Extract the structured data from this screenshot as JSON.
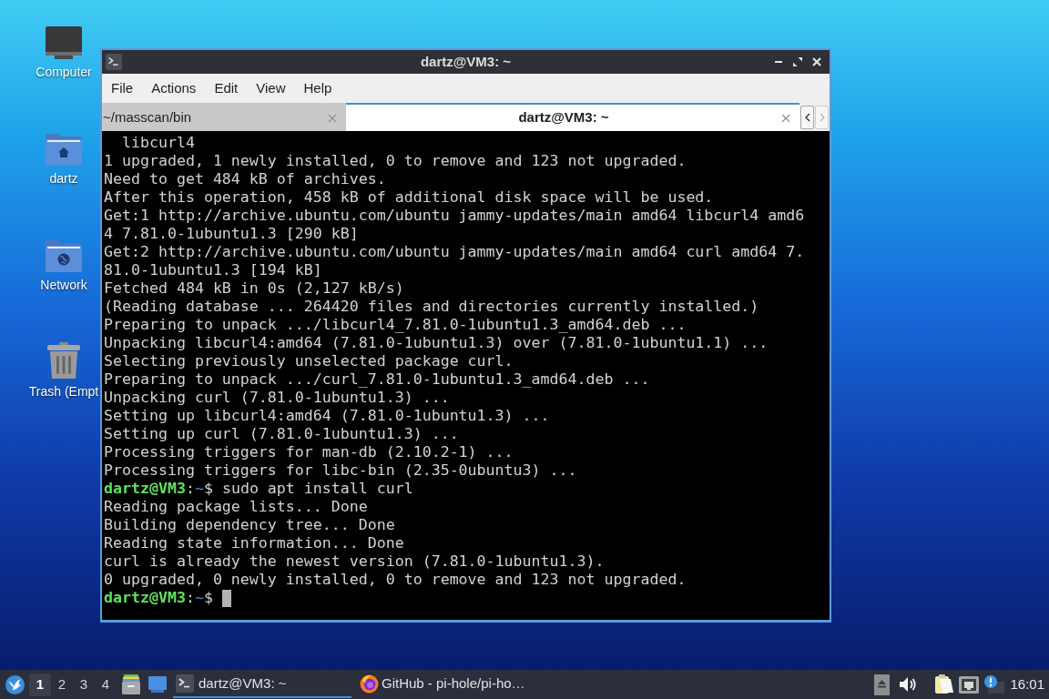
{
  "desktop_icons": [
    {
      "kind": "computer",
      "label": "Computer"
    },
    {
      "kind": "home",
      "label": "dartz"
    },
    {
      "kind": "network",
      "label": "Network"
    },
    {
      "kind": "trash",
      "label": "Trash (Empt"
    }
  ],
  "window": {
    "title": "dartz@VM3: ~",
    "menu": [
      "File",
      "Actions",
      "Edit",
      "View",
      "Help"
    ],
    "tabs": [
      {
        "label": "~/masscan/bin",
        "selected": false
      },
      {
        "label": "dartz@VM3: ~",
        "selected": true
      }
    ],
    "tab_scroll": {
      "back_enabled": true,
      "forward_enabled": false
    },
    "terminal": {
      "lines": [
        {
          "kind": "output",
          "text": "  libcurl4"
        },
        {
          "kind": "output",
          "text": "1 upgraded, 1 newly installed, 0 to remove and 123 not upgraded."
        },
        {
          "kind": "output",
          "text": "Need to get 484 kB of archives."
        },
        {
          "kind": "output",
          "text": "After this operation, 458 kB of additional disk space will be used."
        },
        {
          "kind": "output",
          "text": "Get:1 http://archive.ubuntu.com/ubuntu jammy-updates/main amd64 libcurl4 amd6"
        },
        {
          "kind": "output",
          "text": "4 7.81.0-1ubuntu1.3 [290 kB]"
        },
        {
          "kind": "output",
          "text": "Get:2 http://archive.ubuntu.com/ubuntu jammy-updates/main amd64 curl amd64 7."
        },
        {
          "kind": "output",
          "text": "81.0-1ubuntu1.3 [194 kB]"
        },
        {
          "kind": "output",
          "text": "Fetched 484 kB in 0s (2,127 kB/s)"
        },
        {
          "kind": "output",
          "text": "(Reading database ... 264420 files and directories currently installed.)"
        },
        {
          "kind": "output",
          "text": "Preparing to unpack .../libcurl4_7.81.0-1ubuntu1.3_amd64.deb ..."
        },
        {
          "kind": "output",
          "text": "Unpacking libcurl4:amd64 (7.81.0-1ubuntu1.3) over (7.81.0-1ubuntu1.1) ..."
        },
        {
          "kind": "output",
          "text": "Selecting previously unselected package curl."
        },
        {
          "kind": "output",
          "text": "Preparing to unpack .../curl_7.81.0-1ubuntu1.3_amd64.deb ..."
        },
        {
          "kind": "output",
          "text": "Unpacking curl (7.81.0-1ubuntu1.3) ..."
        },
        {
          "kind": "output",
          "text": "Setting up libcurl4:amd64 (7.81.0-1ubuntu1.3) ..."
        },
        {
          "kind": "output",
          "text": "Setting up curl (7.81.0-1ubuntu1.3) ..."
        },
        {
          "kind": "output",
          "text": "Processing triggers for man-db (2.10.2-1) ..."
        },
        {
          "kind": "output",
          "text": "Processing triggers for libc-bin (2.35-0ubuntu3) ..."
        },
        {
          "kind": "prompt",
          "user": "dartz@VM3",
          "separator": ":",
          "path": "~",
          "symbol": "$",
          "command": "sudo apt install curl",
          "cursor": false
        },
        {
          "kind": "output",
          "text": "Reading package lists... Done"
        },
        {
          "kind": "output",
          "text": "Building dependency tree... Done"
        },
        {
          "kind": "output",
          "text": "Reading state information... Done"
        },
        {
          "kind": "output",
          "text": "curl is already the newest version (7.81.0-1ubuntu1.3)."
        },
        {
          "kind": "output",
          "text": "0 upgraded, 0 newly installed, 0 to remove and 123 not upgraded."
        },
        {
          "kind": "prompt",
          "user": "dartz@VM3",
          "separator": ":",
          "path": "~",
          "symbol": "$",
          "cursor": true
        }
      ]
    }
  },
  "taskbar": {
    "workspaces": [
      {
        "label": "1",
        "selected": true
      },
      {
        "label": "2",
        "selected": false
      },
      {
        "label": "3",
        "selected": false
      },
      {
        "label": "4",
        "selected": false
      }
    ],
    "tasks": [
      {
        "kind": "terminal",
        "label": "dartz@VM3: ~",
        "selected": true
      },
      {
        "kind": "browser",
        "label": "GitHub - pi-hole/pi-ho…",
        "selected": false
      }
    ],
    "clock": "16:01"
  }
}
